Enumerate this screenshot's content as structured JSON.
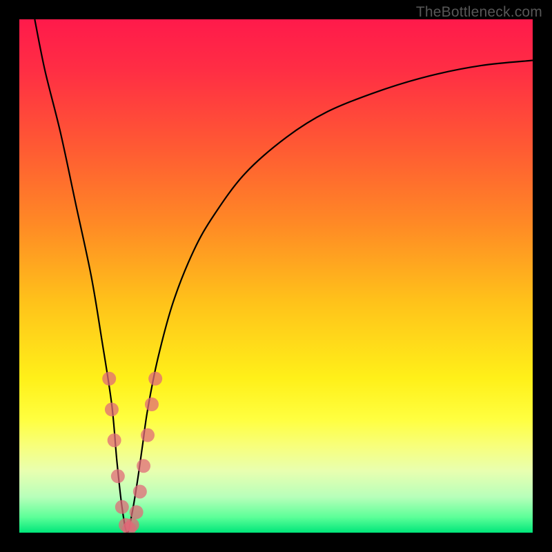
{
  "watermark": "TheBottleneck.com",
  "gradient_stops": [
    {
      "offset": 0.0,
      "color": "#ff1a4b"
    },
    {
      "offset": 0.1,
      "color": "#ff2e44"
    },
    {
      "offset": 0.25,
      "color": "#ff5a33"
    },
    {
      "offset": 0.4,
      "color": "#ff8a25"
    },
    {
      "offset": 0.55,
      "color": "#ffc21a"
    },
    {
      "offset": 0.7,
      "color": "#fff019"
    },
    {
      "offset": 0.78,
      "color": "#ffff40"
    },
    {
      "offset": 0.83,
      "color": "#f8ff7a"
    },
    {
      "offset": 0.88,
      "color": "#e8ffb0"
    },
    {
      "offset": 0.93,
      "color": "#b8ffba"
    },
    {
      "offset": 0.97,
      "color": "#5cff98"
    },
    {
      "offset": 1.0,
      "color": "#00e67a"
    }
  ],
  "chart_data": {
    "type": "line",
    "title": "",
    "xlabel": "",
    "ylabel": "",
    "xlim": [
      0,
      100
    ],
    "ylim": [
      0,
      100
    ],
    "x_min_at": 21,
    "series": [
      {
        "name": "bottleneck-curve",
        "color": "#000000",
        "x": [
          3,
          5,
          8,
          11,
          14,
          16,
          18,
          19,
          20,
          21,
          22,
          23,
          24,
          25,
          27,
          30,
          34,
          38,
          44,
          52,
          60,
          70,
          80,
          90,
          100
        ],
        "values": [
          100,
          90,
          78,
          64,
          50,
          38,
          25,
          14,
          5,
          0,
          4,
          10,
          17,
          24,
          34,
          45,
          55,
          62,
          70,
          77,
          82,
          86,
          89,
          91,
          92
        ]
      }
    ],
    "markers": {
      "name": "sample-points",
      "color": "#e06a78",
      "radius": 10,
      "points": [
        {
          "x": 17.5,
          "y": 30
        },
        {
          "x": 18.0,
          "y": 24
        },
        {
          "x": 18.5,
          "y": 18
        },
        {
          "x": 19.2,
          "y": 11
        },
        {
          "x": 20.0,
          "y": 5
        },
        {
          "x": 20.7,
          "y": 1.5
        },
        {
          "x": 21.4,
          "y": 0.8
        },
        {
          "x": 22.0,
          "y": 1.5
        },
        {
          "x": 22.8,
          "y": 4
        },
        {
          "x": 23.5,
          "y": 8
        },
        {
          "x": 24.2,
          "y": 13
        },
        {
          "x": 25.0,
          "y": 19
        },
        {
          "x": 25.8,
          "y": 25
        },
        {
          "x": 26.5,
          "y": 30
        }
      ]
    }
  }
}
